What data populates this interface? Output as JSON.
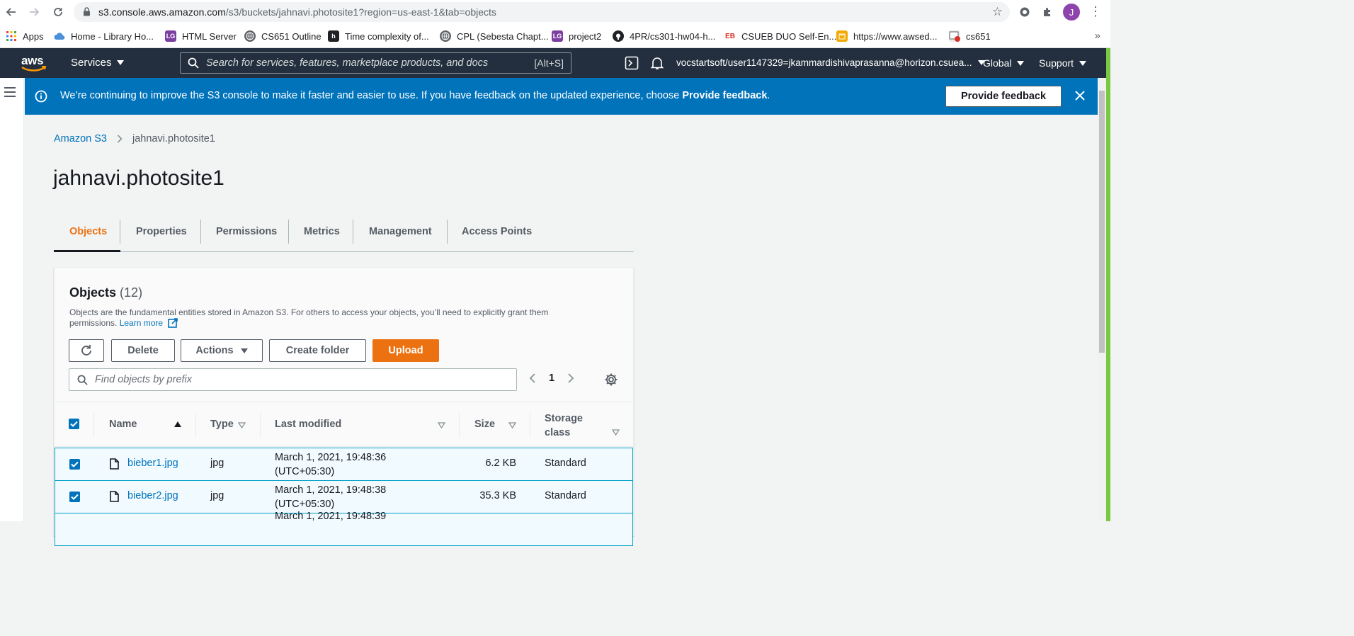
{
  "browser": {
    "url_host": "s3.console.aws.amazon.com",
    "url_rest": "/s3/buckets/jahnavi.photosite1?region=us-east-1&tab=objects",
    "avatar_letter": "J",
    "bookmarks": [
      {
        "label": "Apps",
        "icon": "apps-grid-icon"
      },
      {
        "label": "Home - Library Ho...",
        "icon": "cloud-icon"
      },
      {
        "label": "HTML Server",
        "icon": "lg-icon"
      },
      {
        "label": "CS651 Outline",
        "icon": "globe-icon"
      },
      {
        "label": "Time complexity of...",
        "icon": "h-icon"
      },
      {
        "label": "CPL (Sebesta Chapt...",
        "icon": "globe-icon"
      },
      {
        "label": "project2",
        "icon": "lg-icon"
      },
      {
        "label": "4PR/cs301-hw04-h...",
        "icon": "github-icon"
      },
      {
        "label": "CSUEB DUO Self-En...",
        "icon": "eb-icon"
      },
      {
        "label": "https://www.awsed...",
        "icon": "box-icon"
      },
      {
        "label": "cs651",
        "icon": "cs651-icon"
      }
    ]
  },
  "aws": {
    "services_label": "Services",
    "search_placeholder": "Search for services, features, marketplace products, and docs",
    "search_shortcut": "[Alt+S]",
    "account": "vocstartsoft/user1147329=jkammardishivaprasanna@horizon.csuea...",
    "region": "Global",
    "support": "Support"
  },
  "flash": {
    "message_prefix": "We’re continuing to improve the S3 console to make it faster and easier to use. If you have feedback on the updated experience, choose ",
    "message_bold": "Provide feedback",
    "message_suffix": ".",
    "button_label": "Provide feedback"
  },
  "breadcrumb": {
    "root": "Amazon S3",
    "current": "jahnavi.photosite1"
  },
  "page_title": "jahnavi.photosite1",
  "tabs": [
    "Objects",
    "Properties",
    "Permissions",
    "Metrics",
    "Management",
    "Access Points"
  ],
  "objects_panel": {
    "title": "Objects",
    "count": "(12)",
    "description": "Objects are the fundamental entities stored in Amazon S3. For others to access your objects, you’ll need to explicitly grant them permissions.",
    "learn_more": "Learn more",
    "buttons": {
      "delete": "Delete",
      "actions": "Actions",
      "create_folder": "Create folder",
      "upload": "Upload"
    },
    "find_placeholder": "Find objects by prefix",
    "page_number": "1",
    "columns": {
      "name": "Name",
      "type": "Type",
      "last_modified": "Last modified",
      "size": "Size",
      "storage_class_line1": "Storage",
      "storage_class_line2": "class"
    },
    "rows": [
      {
        "name": "bieber1.jpg",
        "type": "jpg",
        "modified_line1": "March 1, 2021, 19:48:36",
        "modified_line2": "(UTC+05:30)",
        "size": "6.2 KB",
        "storage": "Standard",
        "checked": true
      },
      {
        "name": "bieber2.jpg",
        "type": "jpg",
        "modified_line1": "March 1, 2021, 19:48:38",
        "modified_line2": "(UTC+05:30)",
        "size": "35.3 KB",
        "storage": "Standard",
        "checked": true
      },
      {
        "name": "",
        "type": "",
        "modified_line1": "March 1, 2021, 19:48:39",
        "modified_line2": "",
        "size": "",
        "storage": "",
        "checked": true
      }
    ]
  },
  "colors": {
    "aws_header": "#232f3e",
    "flash_blue": "#0073bb",
    "accent_orange": "#ec7211",
    "link_blue": "#0073bb",
    "selected_row_border": "#00a1c9"
  }
}
